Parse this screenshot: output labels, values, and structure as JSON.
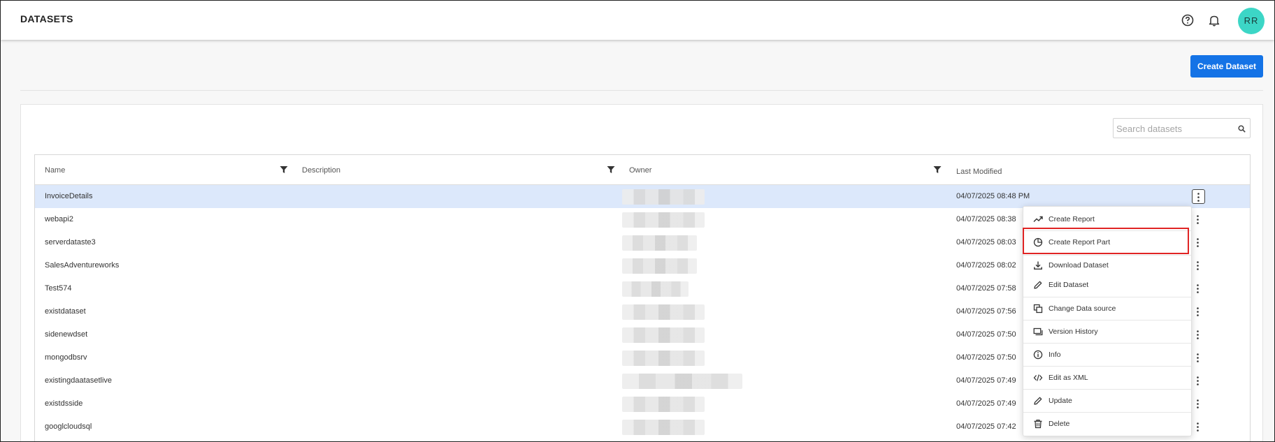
{
  "header": {
    "title": "DATASETS",
    "avatar_initials": "RR"
  },
  "toolbar": {
    "create_label": "Create Dataset"
  },
  "search": {
    "placeholder": "Search datasets"
  },
  "table": {
    "columns": [
      "Name",
      "Description",
      "Owner",
      "Last Modified"
    ],
    "rows": [
      {
        "name": "InvoiceDetails",
        "modified": "04/07/2025 08:48 PM"
      },
      {
        "name": "webapi2",
        "modified": "04/07/2025 08:38"
      },
      {
        "name": "serverdataste3",
        "modified": "04/07/2025 08:03"
      },
      {
        "name": "SalesAdventureworks",
        "modified": "04/07/2025 08:02"
      },
      {
        "name": "Test574",
        "modified": "04/07/2025 07:58"
      },
      {
        "name": "existdataset",
        "modified": "04/07/2025 07:56"
      },
      {
        "name": "sidenewdset",
        "modified": "04/07/2025 07:50"
      },
      {
        "name": "mongodbsrv",
        "modified": "04/07/2025 07:50"
      },
      {
        "name": "existingdaatasetlive",
        "modified": "04/07/2025 07:49"
      },
      {
        "name": "existdsside",
        "modified": "04/07/2025 07:49"
      },
      {
        "name": "googlcloudsql",
        "modified": "04/07/2025 07:42"
      }
    ]
  },
  "context_menu": {
    "items": [
      {
        "label": "Create Report",
        "icon": "trending-up-icon"
      },
      {
        "label": "Create Report Part",
        "icon": "pie-chart-icon"
      },
      {
        "label": "Download Dataset",
        "icon": "download-icon"
      },
      {
        "label": "Edit Dataset",
        "icon": "pencil-icon"
      },
      {
        "label": "Change Data source",
        "icon": "copy-icon"
      },
      {
        "label": "Version History",
        "icon": "history-icon"
      },
      {
        "label": "Info",
        "icon": "info-icon"
      },
      {
        "label": "Edit as XML",
        "icon": "code-icon"
      },
      {
        "label": "Update",
        "icon": "pencil-icon"
      },
      {
        "label": "Delete",
        "icon": "trash-icon"
      }
    ]
  },
  "colors": {
    "primary": "#1473e6",
    "avatar": "#3cd6c6",
    "selected_row": "#dce8fb",
    "highlight": "#e02424"
  }
}
